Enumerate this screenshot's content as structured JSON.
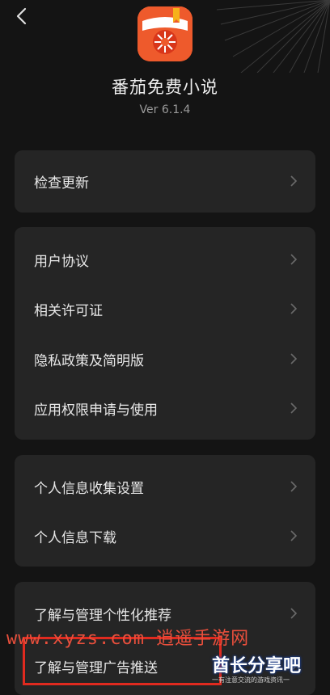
{
  "app": {
    "name": "番茄免费小说",
    "version": "Ver 6.1.4"
  },
  "colors": {
    "background": "#141414",
    "card": "#252525",
    "accent": "#e8461f",
    "highlight_box": "#e02a1f"
  },
  "icons": {
    "back": "chevron-left-icon",
    "row_arrow": "chevron-right-icon",
    "app_logo": "tomato-book-icon"
  },
  "menu": {
    "group1": [
      {
        "label": "检查更新"
      }
    ],
    "group2": [
      {
        "label": "用户协议"
      },
      {
        "label": "相关许可证"
      },
      {
        "label": "隐私政策及简明版"
      },
      {
        "label": "应用权限申请与使用"
      }
    ],
    "group3": [
      {
        "label": "个人信息收集设置"
      },
      {
        "label": "个人信息下载"
      }
    ],
    "group4": [
      {
        "label": "了解与管理个性化推荐"
      },
      {
        "label": "了解与管理广告推送"
      }
    ]
  },
  "watermark": {
    "site": "www.xyzs.com 逍遥手游网",
    "brand": "酋长分享吧",
    "tagline": "一有注意交流的游戏资讯一"
  }
}
